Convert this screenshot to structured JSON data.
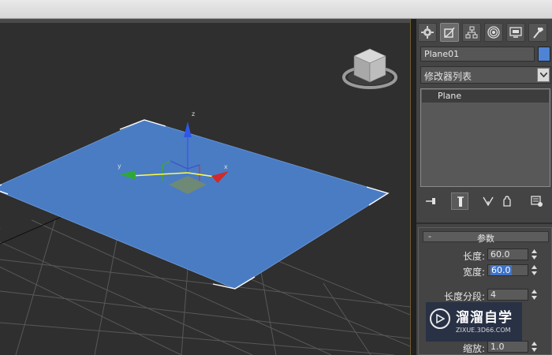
{
  "viewport": {
    "axes": {
      "x": "x",
      "y": "y",
      "z": "z"
    }
  },
  "command_panel": {
    "tabs": [
      {
        "name": "create",
        "icon": "create-icon"
      },
      {
        "name": "modify",
        "icon": "modify-icon",
        "active": true
      },
      {
        "name": "hierarchy",
        "icon": "hierarchy-icon"
      },
      {
        "name": "motion",
        "icon": "motion-icon"
      },
      {
        "name": "display",
        "icon": "display-icon"
      },
      {
        "name": "utilities",
        "icon": "hammer-icon"
      }
    ],
    "object_name": "Plane01",
    "object_color": "#4f83d4",
    "modifier_list_label": "修改器列表",
    "modifier_stack": [
      "Plane"
    ],
    "stack_tools": [
      "pin-stack-icon",
      "show-end-result-icon",
      "make-unique-icon",
      "remove-modifier-icon",
      "configure-modifier-sets-icon"
    ]
  },
  "parameters": {
    "title": "参数",
    "collapse_symbol": "-",
    "length_label": "长度:",
    "length_value": "60.0",
    "width_label": "宽度:",
    "width_value": "60.0",
    "length_segs_label": "长度分段:",
    "length_segs_value": "4",
    "scale_label": "缩放:",
    "scale_value": "1.0"
  },
  "watermark": {
    "main": "溜溜自学",
    "sub": "ZIXUE.3D66.COM"
  },
  "colors": {
    "plane": "#4a7cc4",
    "selection": "#3f73c8",
    "background": "#2f2f2f"
  }
}
